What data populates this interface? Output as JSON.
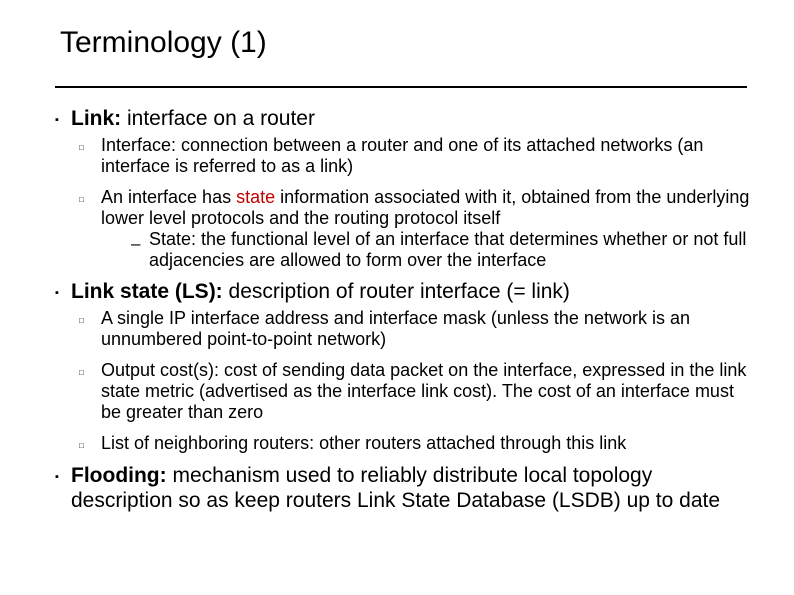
{
  "title": "Terminology (1)",
  "sections": [
    {
      "term": "Link:",
      "rest": " interface on a router",
      "subs": [
        {
          "text": "Interface: connection between a router and one of its attached networks (an interface is referred to as a link)"
        },
        {
          "pre": "An interface has ",
          "red": "state",
          "post": " information associated with it, obtained from the underlying lower level protocols and the routing protocol itself",
          "children": [
            {
              "text": "State: the functional level of an interface that determines whether or not full adjacencies are allowed to form over the interface"
            }
          ]
        }
      ]
    },
    {
      "term": "Link state (LS):",
      "rest": " description of router interface (= link)",
      "subs": [
        {
          "text": "A single IP interface address and interface mask (unless the network is an unnumbered point-to-point network)"
        },
        {
          "text": "Output cost(s): cost of sending data packet on the interface, expressed in the link state metric (advertised as the interface link cost). The cost of an interface must be greater than zero"
        },
        {
          "text": "List of neighboring routers: other routers attached through this link"
        }
      ]
    },
    {
      "term": "Flooding:",
      "rest": " mechanism used to reliably distribute local topology description so as keep routers Link State Database (LSDB) up to date"
    }
  ],
  "bullets": {
    "l1": "▪",
    "l2": "□",
    "l3": "–"
  }
}
